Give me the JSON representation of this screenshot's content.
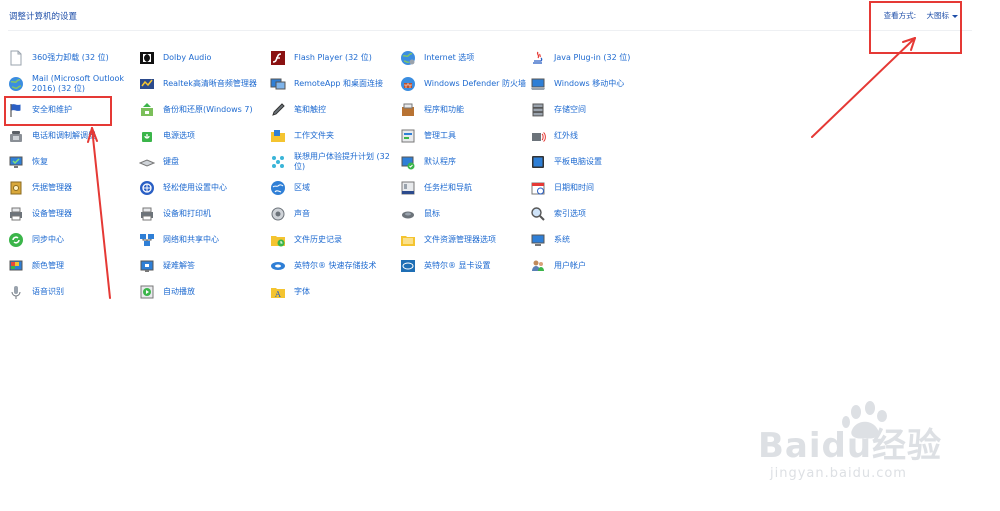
{
  "header": {
    "title": "调整计算机的设置",
    "view_label": "查看方式:",
    "view_value": "大图标"
  },
  "items": [
    {
      "label": "360强力卸载 (32 位)",
      "icon": "doc-icon"
    },
    {
      "label": "Mail (Microsoft Outlook 2016) (32 位)",
      "icon": "globe-icon"
    },
    {
      "label": "安全和维护",
      "icon": "flag-icon"
    },
    {
      "label": "电话和调制解调器",
      "icon": "phone-icon"
    },
    {
      "label": "恢复",
      "icon": "monitor-icon"
    },
    {
      "label": "凭据管理器",
      "icon": "vault-icon"
    },
    {
      "label": "设备管理器",
      "icon": "printer-icon"
    },
    {
      "label": "同步中心",
      "icon": "sync-icon"
    },
    {
      "label": "颜色管理",
      "icon": "color-icon"
    },
    {
      "label": "语音识别",
      "icon": "mic-icon"
    },
    {
      "label": "Dolby Audio",
      "icon": "dolby-icon"
    },
    {
      "label": "Realtek高清晰音频管理器",
      "icon": "audio-icon"
    },
    {
      "label": "备份和还原(Windows 7)",
      "icon": "backup-icon"
    },
    {
      "label": "电源选项",
      "icon": "power-icon"
    },
    {
      "label": "键盘",
      "icon": "keyboard-icon"
    },
    {
      "label": "轻松使用设置中心",
      "icon": "ease-icon"
    },
    {
      "label": "设备和打印机",
      "icon": "printer-icon"
    },
    {
      "label": "网络和共享中心",
      "icon": "network-icon"
    },
    {
      "label": "疑难解答",
      "icon": "troubleshoot-icon"
    },
    {
      "label": "自动播放",
      "icon": "autoplay-icon"
    },
    {
      "label": "Flash Player (32 位)",
      "icon": "flash-icon"
    },
    {
      "label": "RemoteApp 和桌面连接",
      "icon": "remote-icon"
    },
    {
      "label": "笔和触控",
      "icon": "pen-icon"
    },
    {
      "label": "工作文件夹",
      "icon": "folder-icon"
    },
    {
      "label": "联想用户体验提升计划 (32 位)",
      "icon": "lenovo-icon"
    },
    {
      "label": "区域",
      "icon": "region-icon"
    },
    {
      "label": "声音",
      "icon": "sound-icon"
    },
    {
      "label": "文件历史记录",
      "icon": "history-icon"
    },
    {
      "label": "英特尔® 快速存储技术",
      "icon": "intel-storage-icon"
    },
    {
      "label": "字体",
      "icon": "font-icon"
    },
    {
      "label": "Internet 选项",
      "icon": "internet-icon"
    },
    {
      "label": "Windows Defender 防火墙",
      "icon": "firewall-icon"
    },
    {
      "label": "程序和功能",
      "icon": "programs-icon"
    },
    {
      "label": "管理工具",
      "icon": "admin-icon"
    },
    {
      "label": "默认程序",
      "icon": "default-icon"
    },
    {
      "label": "任务栏和导航",
      "icon": "taskbar-icon"
    },
    {
      "label": "鼠标",
      "icon": "mouse-icon"
    },
    {
      "label": "文件资源管理器选项",
      "icon": "folder-options-icon"
    },
    {
      "label": "英特尔® 显卡设置",
      "icon": "intel-graphics-icon"
    },
    {
      "label": "Java Plug-in (32 位)",
      "icon": "java-icon"
    },
    {
      "label": "Windows 移动中心",
      "icon": "mobility-icon"
    },
    {
      "label": "存储空间",
      "icon": "storage-icon"
    },
    {
      "label": "红外线",
      "icon": "infrared-icon"
    },
    {
      "label": "平板电脑设置",
      "icon": "tablet-icon"
    },
    {
      "label": "日期和时间",
      "icon": "datetime-icon"
    },
    {
      "label": "索引选项",
      "icon": "index-icon"
    },
    {
      "label": "系统",
      "icon": "system-icon"
    },
    {
      "label": "用户帐户",
      "icon": "users-icon"
    }
  ],
  "watermark": {
    "logo": "Baidu经验",
    "url": "jingyan.baidu.com"
  },
  "colors": {
    "link": "#1e6ad0",
    "title": "#1e4ea8",
    "annotation": "#e53935"
  }
}
